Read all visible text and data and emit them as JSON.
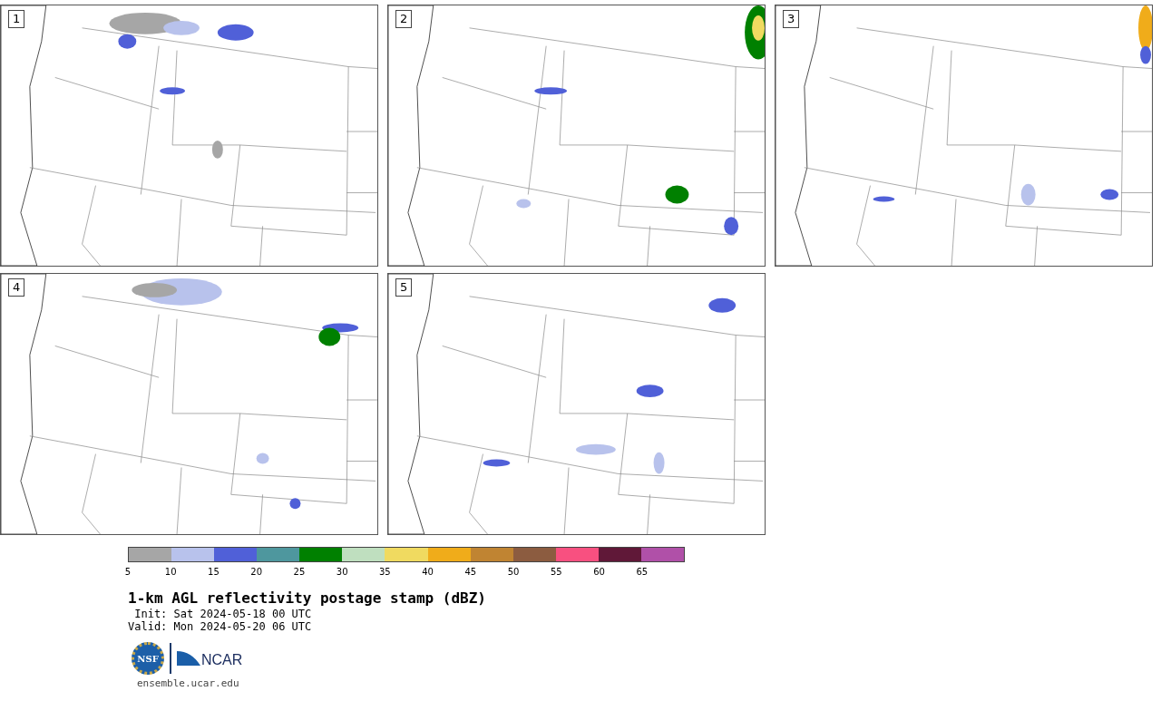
{
  "panels": [
    {
      "label": "1"
    },
    {
      "label": "2"
    },
    {
      "label": "3"
    },
    {
      "label": "4"
    },
    {
      "label": "5"
    }
  ],
  "colorbar": {
    "segments": [
      {
        "color": "#a6a6a6",
        "tick": "5"
      },
      {
        "color": "#b8c2ec",
        "tick": "10"
      },
      {
        "color": "#5060d8",
        "tick": "15"
      },
      {
        "color": "#4e979e",
        "tick": "20"
      },
      {
        "color": "#008000",
        "tick": "25"
      },
      {
        "color": "#bfdfbf",
        "tick": "30"
      },
      {
        "color": "#f0da60",
        "tick": "35"
      },
      {
        "color": "#f0ac1a",
        "tick": "40"
      },
      {
        "color": "#c08432",
        "tick": "45"
      },
      {
        "color": "#8c5c40",
        "tick": "50"
      },
      {
        "color": "#f85080",
        "tick": "55"
      },
      {
        "color": "#601838",
        "tick": "60"
      },
      {
        "color": "#b050a8",
        "tick": "65"
      }
    ]
  },
  "title": "1-km AGL reflectivity postage stamp (dBZ)",
  "init": " Init: Sat 2024-05-18 00 UTC",
  "valid": "Valid: Mon 2024-05-20 06 UTC",
  "logos": {
    "left": "NSF",
    "right": "NCAR"
  },
  "footer": "ensemble.ucar.edu"
}
